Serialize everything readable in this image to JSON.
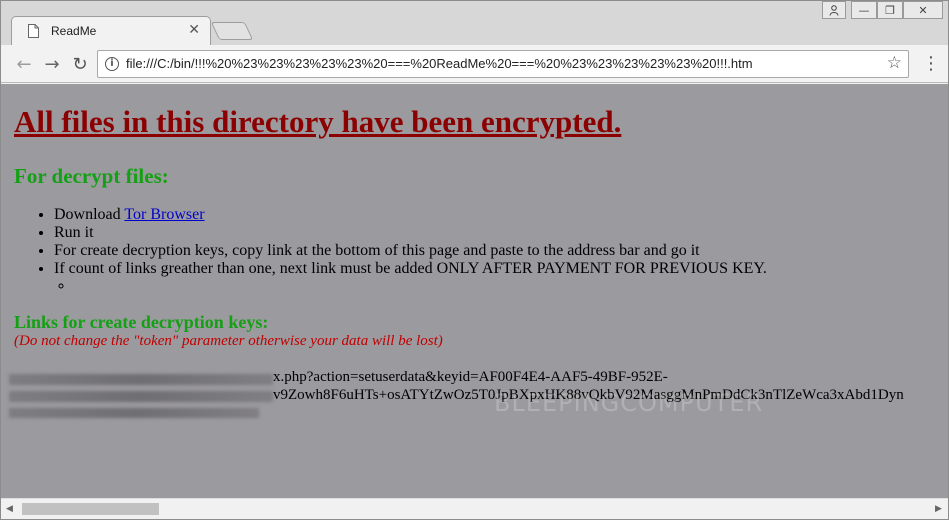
{
  "tab": {
    "title": "ReadMe",
    "close": "✕"
  },
  "toolbar": {
    "back": "←",
    "forward": "→",
    "reload": "↻",
    "info": "i",
    "url": "file:///C:/bin/!!!%20%23%23%23%23%23%20===%20ReadMe%20===%20%23%23%23%23%23%20!!!.htm",
    "star": "☆",
    "menu": "⋮"
  },
  "window_controls": {
    "user": "👤",
    "minimize": "—",
    "restore": "❐",
    "close": "✕"
  },
  "page": {
    "heading": "All files in this directory have been encrypted.",
    "subheading": "For decrypt files:",
    "steps": {
      "download_prefix": "Download ",
      "download_link": "Tor Browser",
      "run": "Run it",
      "create": "For create decryption keys, copy link at the bottom of this page and paste to the address bar and go it",
      "multiple": "If count of links greather than one, next link must be added ONLY AFTER PAYMENT FOR PREVIOUS KEY."
    },
    "links_heading": "Links for create decryption keys:",
    "warning": "(Do not change the \"token\" parameter otherwise your data will be lost)",
    "link_line_1": "x.php?action=setuserdata&keyid=AF00F4E4-AAF5-49BF-952E-",
    "link_line_2": "v9Zowh8F6uHTs+osATYtZwOz5T0JpBXpxHK88vQkbV92MasggMnPmDdCk3nTlZeWca3xAbd1Dyn",
    "watermark": "BLEEPINGCOMPUTER"
  },
  "scrollbar": {
    "left": "◀",
    "right": "▶"
  }
}
